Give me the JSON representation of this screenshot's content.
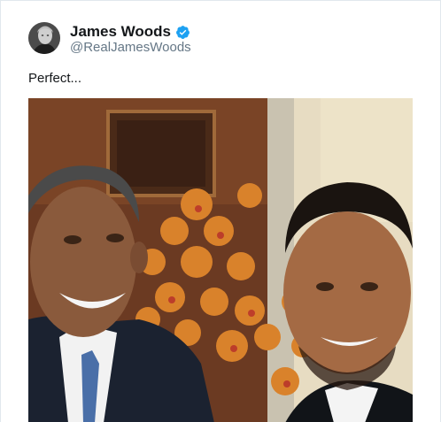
{
  "tweet": {
    "display_name": "James Woods",
    "handle": "@RealJamesWoods",
    "verified": true,
    "text": "Perfect...",
    "avatar_icon": "profile-photo",
    "verified_icon": "verified-badge-icon",
    "media_description_icon": "photo"
  },
  "colors": {
    "verified_blue": "#1da1f2",
    "name": "#14171a",
    "handle": "#657786",
    "border": "#e1e8ed"
  }
}
